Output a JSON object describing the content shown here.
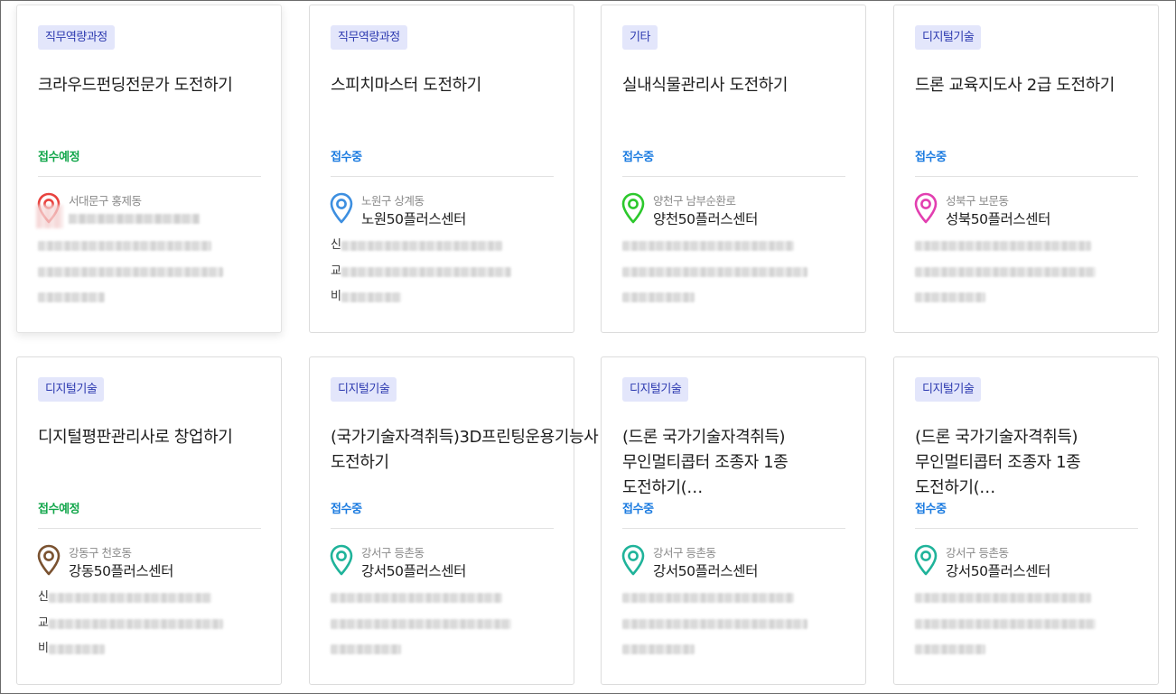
{
  "cards": [
    {
      "category": "직무역량과정",
      "title": "크라우드펀딩전문가 도전하기",
      "status": "접수예정",
      "status_type": "upcoming",
      "district": "서대문구 홍제동",
      "center": "",
      "pin_color": "#e8423e",
      "pin_icon": "map-pin-icon",
      "info_labels": [
        "",
        "",
        ""
      ]
    },
    {
      "category": "직무역량과정",
      "title": "스피치마스터 도전하기",
      "status": "접수중",
      "status_type": "open",
      "district": "노원구 상계동",
      "center": "노원50플러스센터",
      "pin_color": "#3d8fe0",
      "pin_icon": "map-pin-icon",
      "info_labels": [
        "신",
        "교",
        "비"
      ]
    },
    {
      "category": "기타",
      "title": "실내식물관리사 도전하기",
      "status": "접수중",
      "status_type": "open",
      "district": "양천구 남부순환로",
      "center": "양천50플러스센터",
      "pin_color": "#2cc82c",
      "pin_icon": "map-pin-icon",
      "info_labels": [
        "",
        "",
        ""
      ]
    },
    {
      "category": "디지털기술",
      "title": "드론 교육지도사 2급 도전하기",
      "status": "접수중",
      "status_type": "open",
      "district": "성북구 보문동",
      "center": "성북50플러스센터",
      "pin_color": "#e23fb0",
      "pin_icon": "map-pin-icon",
      "info_labels": [
        "",
        "",
        ""
      ]
    },
    {
      "category": "디지털기술",
      "title": "디지털평판관리사로 창업하기",
      "status": "접수예정",
      "status_type": "upcoming",
      "district": "강동구 천호동",
      "center": "강동50플러스센터",
      "pin_color": "#7a5230",
      "pin_icon": "map-pin-icon",
      "info_labels": [
        "신",
        "교",
        "비"
      ]
    },
    {
      "category": "디지털기술",
      "title": "(국가기술자격취득)3D프린팅운용기능사 도전하기",
      "status": "접수중",
      "status_type": "open",
      "district": "강서구 등촌동",
      "center": "강서50플러스센터",
      "pin_color": "#1fb39a",
      "pin_icon": "map-pin-icon",
      "info_labels": [
        "",
        "",
        ""
      ]
    },
    {
      "category": "디지털기술",
      "title": "(드론 국가기술자격취득) 무인멀티콥터 조종자 1종 도전하기(…",
      "status": "접수중",
      "status_type": "open",
      "district": "강서구 등촌동",
      "center": "강서50플러스센터",
      "pin_color": "#1fb39a",
      "pin_icon": "map-pin-icon",
      "info_labels": [
        "",
        "",
        ""
      ]
    },
    {
      "category": "디지털기술",
      "title": "(드론 국가기술자격취득) 무인멀티콥터 조종자 1종 도전하기(…",
      "status": "접수중",
      "status_type": "open",
      "district": "강서구 등촌동",
      "center": "강서50플러스센터",
      "pin_color": "#1fb39a",
      "pin_icon": "map-pin-icon",
      "info_labels": [
        "",
        "",
        ""
      ]
    }
  ]
}
